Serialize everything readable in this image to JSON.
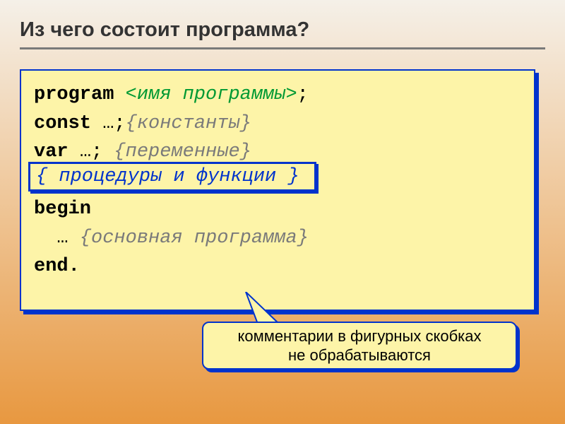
{
  "title": "Из чего состоит программа?",
  "code": {
    "kw_program": "program ",
    "program_name": "<имя программы>",
    "semicolon": ";",
    "kw_const": "const ",
    "const_rest": "…;",
    "const_comment": "{константы}",
    "kw_var": "var ",
    "var_rest": "…; ",
    "var_comment": "{переменные}",
    "proc_func": "{ процедуры и функции }",
    "kw_begin": "begin",
    "main_indent": "  … ",
    "main_comment": "{основная программа}",
    "kw_end": "end."
  },
  "callout": {
    "line1": "комментарии в фигурных скобках",
    "line2": "не обрабатываются"
  }
}
